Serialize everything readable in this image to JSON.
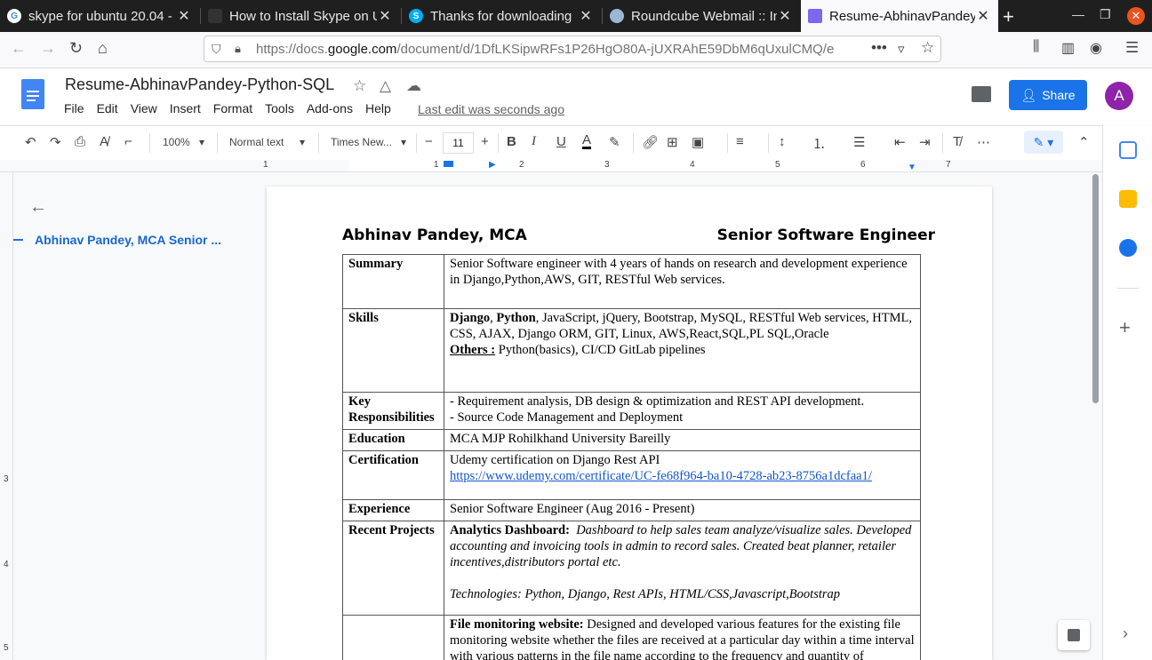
{
  "browser": {
    "tabs": [
      {
        "title": "skype for ubuntu 20.04 -",
        "icon": "google-icon"
      },
      {
        "title": "How to Install Skype on U",
        "icon": "site-icon"
      },
      {
        "title": "Thanks for downloading",
        "icon": "skype-icon"
      },
      {
        "title": "Roundcube Webmail :: In",
        "icon": "roundcube-icon"
      },
      {
        "title": "Resume-AbhinavPandey-",
        "icon": "docs-icon",
        "active": true
      }
    ],
    "url_prefix": "https://docs.",
    "url_domain": "google.com",
    "url_rest": "/document/d/1DfLKSipwRFs1P26HgO80A-jUXRAhE59DbM6qUxulCMQ/e"
  },
  "docs": {
    "title": "Resume-AbhinavPandey-Python-SQL",
    "menu": [
      "File",
      "Edit",
      "View",
      "Insert",
      "Format",
      "Tools",
      "Add-ons",
      "Help"
    ],
    "last_edit": "Last edit was seconds ago",
    "share_label": "Share",
    "avatar_letter": "A",
    "toolbar": {
      "zoom": "100%",
      "style": "Normal text",
      "font": "Times New...",
      "font_size": "11"
    },
    "ruler_numbers": [
      "1",
      "1",
      "2",
      "3",
      "4",
      "5",
      "6",
      "7"
    ],
    "vruler_numbers": [
      "3",
      "4",
      "5"
    ],
    "outline_item": "Abhinav Pandey, MCA Senior ..."
  },
  "resume": {
    "name": "Abhinav Pandey, MCA",
    "role": "Senior Software Engineer",
    "rows": {
      "summary": {
        "label": "Summary",
        "text": "Senior Software engineer with 4 years of hands on research and development experience in Django,Python,AWS, GIT, RESTful Web services."
      },
      "skills": {
        "label": "Skills",
        "django": "Django",
        "python": "Python",
        "rest": ", JavaScript, jQuery, Bootstrap, MySQL, RESTful Web services, HTML, CSS, AJAX, Django ORM, GIT, Linux, AWS,React,SQL,PL SQL,Oracle",
        "others_label": "Others :",
        "others": " Python(basics), CI/CD GitLab pipelines"
      },
      "resp": {
        "label": "Key Responsibilities",
        "line1": "- Requirement analysis, DB design & optimization and REST API development.",
        "line2": "- Source Code Management and Deployment"
      },
      "education": {
        "label": "Education",
        "text": "MCA MJP Rohilkhand University Bareilly"
      },
      "cert": {
        "label": "Certification",
        "text": "Udemy certification on Django Rest API",
        "link": "https://www.udemy.com/certificate/UC-fe68f964-ba10-4728-ab23-8756a1dcfaa1/"
      },
      "experience": {
        "label": "Experience",
        "text": "Senior Software Engineer (Aug 2016 - Present)"
      },
      "projects": {
        "label": "Recent Projects",
        "p1_title": "Analytics Dashboard:",
        "p1_text": "Dashboard to help sales team analyze/visualize sales. Developed accounting and invoicing tools in admin to record sales. Created beat planner, retailer incentives,distributors portal etc.",
        "p1_tech": "Technologies: Python, Django, Rest APIs, HTML/CSS,Javascript,Bootstrap",
        "p2_title": "File monitoring website:",
        "p2_text": " Designed and developed various features for the existing file monitoring website whether the files are received at a particular day within a time interval with various patterns in the file name according to the frequency and quantity of"
      }
    }
  },
  "colors": {
    "accent": "#1a73e8",
    "avatar": "#8e24aa",
    "ubuntu_close": "#e95420"
  }
}
